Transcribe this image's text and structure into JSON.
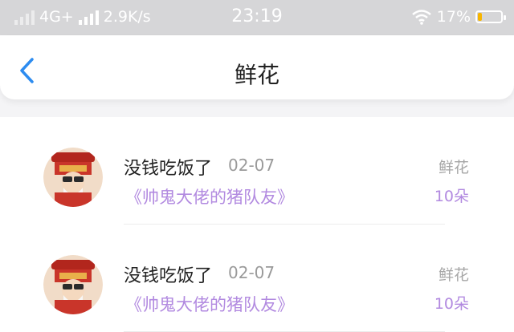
{
  "status_bar": {
    "network": "4G+",
    "speed": "2.9K/s",
    "time": "23:19",
    "battery_percent": "17%",
    "battery_level": 0.17,
    "battery_color": "#f7b500"
  },
  "nav": {
    "back_icon": "chevron-left-icon",
    "title": "鲜花"
  },
  "list": {
    "items": [
      {
        "name": "没钱吃饭了",
        "date": "02-07",
        "book": "《帅鬼大佬的猪队友》",
        "gift_type": "鲜花",
        "count": "10朵"
      },
      {
        "name": "没钱吃饭了",
        "date": "02-07",
        "book": "《帅鬼大佬的猪队友》",
        "gift_type": "鲜花",
        "count": "10朵"
      }
    ]
  },
  "colors": {
    "accent_blue": "#2d8cf0",
    "accent_purple": "#b28ae0"
  }
}
